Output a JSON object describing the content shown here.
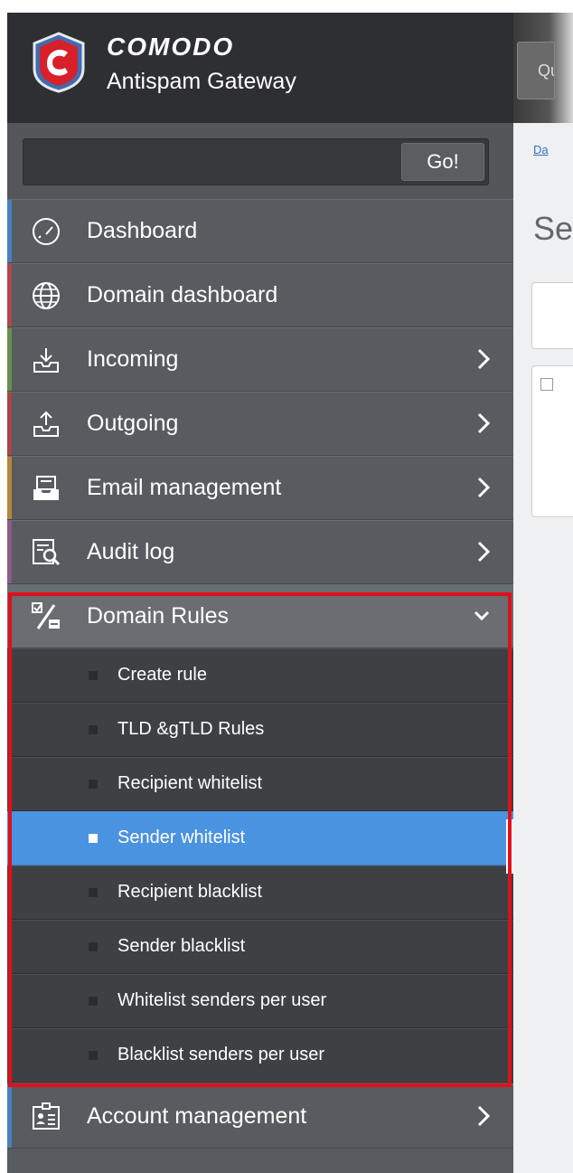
{
  "brand": {
    "name": "COMODO",
    "subtitle": "Antispam Gateway"
  },
  "search": {
    "value": "",
    "placeholder": "",
    "go_label": "Go!"
  },
  "topbar": {
    "button_label": "Qu"
  },
  "content": {
    "breadcrumb": "Da",
    "title": "Se"
  },
  "menu": [
    {
      "label": "Dashboard",
      "icon": "speedometer-icon",
      "accent": "#4a7fc1",
      "has_submenu": false
    },
    {
      "label": "Domain dashboard",
      "icon": "globe-icon",
      "accent": "#b0464f",
      "has_submenu": false
    },
    {
      "label": "Incoming",
      "icon": "inbox-download-icon",
      "accent": "#6b8e4e",
      "has_submenu": true
    },
    {
      "label": "Outgoing",
      "icon": "outbox-upload-icon",
      "accent": "#a9444a",
      "has_submenu": true
    },
    {
      "label": "Email management",
      "icon": "envelope-tray-icon",
      "accent": "#b8863b",
      "has_submenu": true
    },
    {
      "label": "Audit log",
      "icon": "log-search-icon",
      "accent": "#8e5a8a",
      "has_submenu": true
    },
    {
      "label": "Domain Rules",
      "icon": "percent-rules-icon",
      "accent": "#6a6d71",
      "has_submenu": true,
      "expanded": true
    },
    {
      "label": "Account management",
      "icon": "id-card-icon",
      "accent": "#4a7fc1",
      "has_submenu": true
    }
  ],
  "domain_rules_items": [
    {
      "label": "Create rule",
      "active": false
    },
    {
      "label": "TLD &gTLD Rules",
      "active": false
    },
    {
      "label": "Recipient whitelist",
      "active": false
    },
    {
      "label": "Sender whitelist",
      "active": true
    },
    {
      "label": "Recipient blacklist",
      "active": false
    },
    {
      "label": "Sender blacklist",
      "active": false
    },
    {
      "label": "Whitelist senders per user",
      "active": false
    },
    {
      "label": "Blacklist senders per user",
      "active": false
    }
  ],
  "colors": {
    "active_item": "#4a93e0",
    "highlight_border": "#e0101a",
    "sidebar_bg": "#585b5f",
    "brand_bg": "#2e2f33"
  }
}
